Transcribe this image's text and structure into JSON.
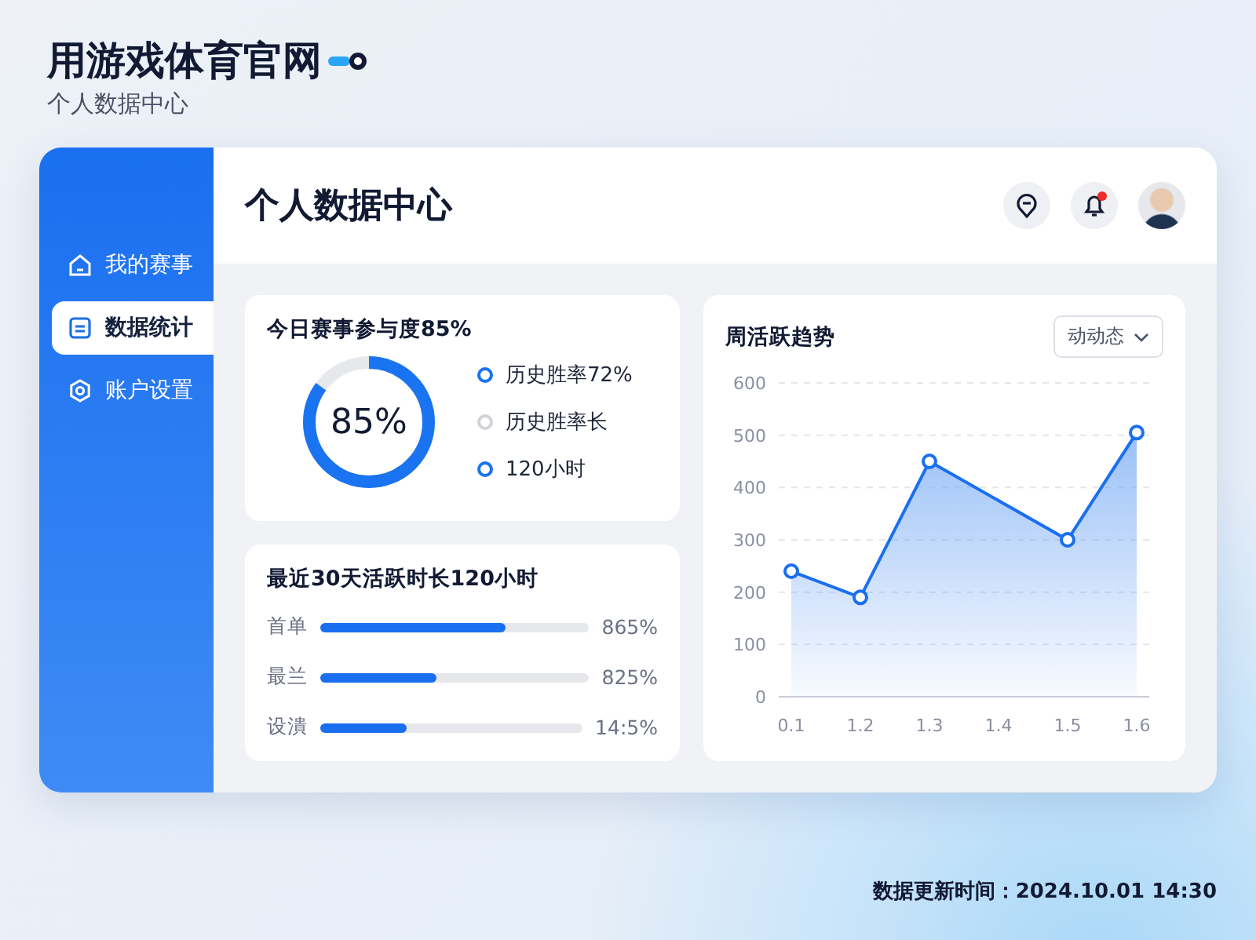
{
  "brand": {
    "title": "用游戏体育官网",
    "subtitle": "个人数据中心"
  },
  "sidebar": {
    "items": [
      {
        "label": "我的赛事",
        "selected": false
      },
      {
        "label": "数据统计",
        "selected": true
      },
      {
        "label": "账户设置",
        "selected": false
      }
    ]
  },
  "header": {
    "title": "个人数据中心",
    "notification": true
  },
  "participation": {
    "title": "今日赛事参与度85%",
    "value": "85%",
    "level": 0.85,
    "legend": [
      {
        "label": "历史胜率72%",
        "color": "#1a73f0"
      },
      {
        "label": "历史胜率长",
        "color": "#d0d3da"
      },
      {
        "label": "120小时",
        "color": "#1a73f0"
      }
    ]
  },
  "activity": {
    "title": "最近30天活跃时长120小时",
    "rows": [
      {
        "label": "首单",
        "level": 0.69,
        "reading": "865%"
      },
      {
        "label": "最兰",
        "level": 0.43,
        "reading": "825%"
      },
      {
        "label": "设潰",
        "level": 0.33,
        "reading": "14:5%"
      }
    ]
  },
  "trend": {
    "title": "周活跃趋势",
    "dropdown": "动动态",
    "chart_data": {
      "type": "area",
      "categories": [
        "0.1",
        "1.2",
        "1.3",
        "1.4",
        "1.5",
        "1.6"
      ],
      "series": [
        {
          "color": "#1a6ff0",
          "values": [
            240,
            190,
            450,
            null,
            300,
            505
          ]
        }
      ],
      "ylim": [
        0,
        600
      ],
      "grid": true,
      "yticks": [
        0,
        100,
        200,
        300,
        400,
        500,
        600
      ]
    }
  },
  "footer": {
    "updated": "数据更新时间：2024.10.01 14:30"
  }
}
